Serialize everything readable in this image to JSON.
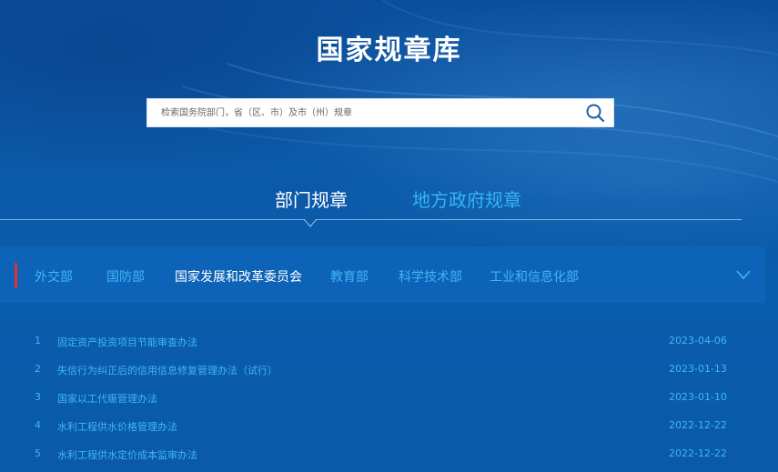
{
  "header": {
    "title": "国家规章库"
  },
  "search": {
    "placeholder": "检索国务院部门，省（区、市）及市（州）规章"
  },
  "tabs": [
    {
      "label": "部门规章",
      "active": true
    },
    {
      "label": "地方政府规章",
      "active": false
    }
  ],
  "ministries": [
    {
      "label": "外交部",
      "active": false
    },
    {
      "label": "国防部",
      "active": false
    },
    {
      "label": "国家发展和改革委员会",
      "active": true
    },
    {
      "label": "教育部",
      "active": false
    },
    {
      "label": "科学技术部",
      "active": false
    },
    {
      "label": "工业和信息化部",
      "active": false
    }
  ],
  "regulations": [
    {
      "num": "1",
      "title": "固定资产投资项目节能审查办法",
      "date": "2023-04-06"
    },
    {
      "num": "2",
      "title": "失信行为纠正后的信用信息修复管理办法（试行）",
      "date": "2023-01-13"
    },
    {
      "num": "3",
      "title": "国家以工代赈管理办法",
      "date": "2023-01-10"
    },
    {
      "num": "4",
      "title": "水利工程供水价格管理办法",
      "date": "2022-12-22"
    },
    {
      "num": "5",
      "title": "水利工程供水定价成本监审办法",
      "date": "2022-12-22"
    }
  ],
  "colors": {
    "accent_blue": "#35b4f5",
    "active_white": "#ffffff",
    "marker_red": "#e0303a",
    "background": "#0a5aa9"
  },
  "icons": {
    "search": "search-icon",
    "expand": "chevron-down-icon"
  }
}
